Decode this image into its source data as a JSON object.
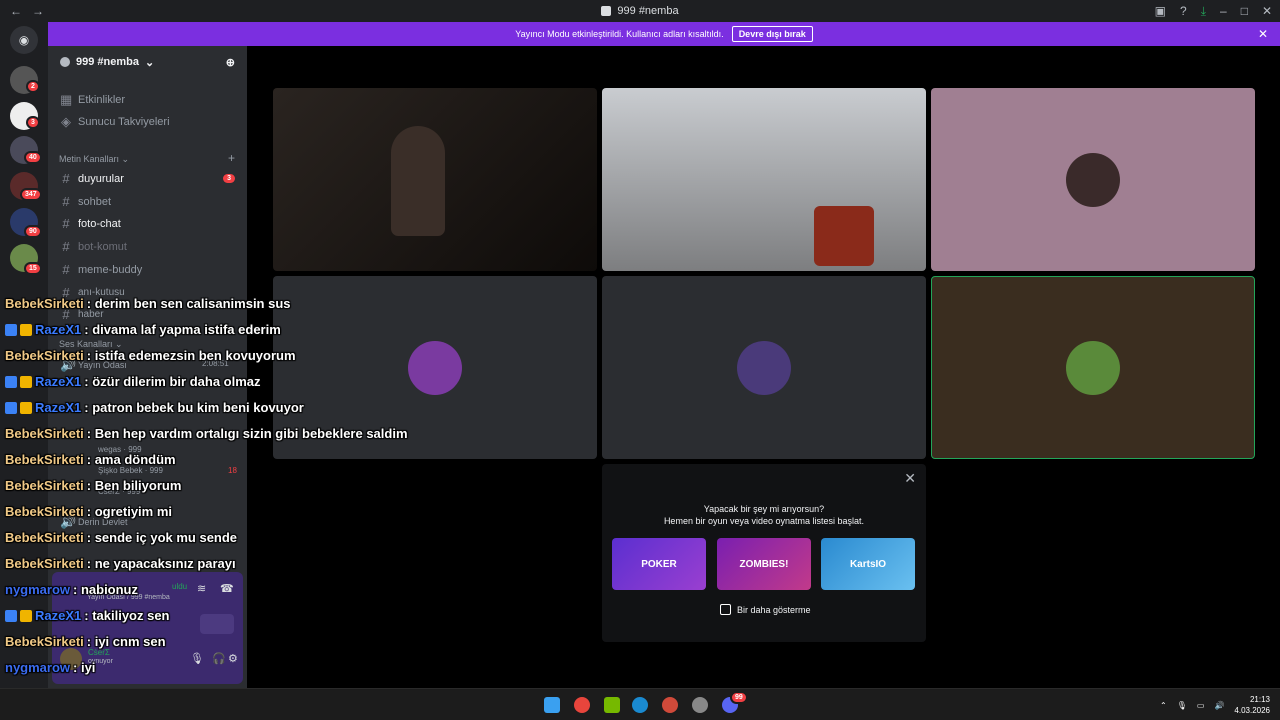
{
  "window": {
    "title": "999 #nemba",
    "back": "←",
    "forward": "→"
  },
  "banner": {
    "text": "Yayıncı Modu etkinleştirildi. Kullanıcı adları kısaltıldı.",
    "button": "Devre dışı bırak"
  },
  "server_badges": [
    "2",
    "3",
    "40",
    "347",
    "90",
    "15"
  ],
  "guild": {
    "name": "999 #nemba",
    "events": "Etkinlikler",
    "boosts": "Sunucu Takviyeleri",
    "text_category": "Metin Kanalları",
    "voice_category": "Ses Kanalları",
    "channels": [
      {
        "name": "duyurular",
        "badge": "3"
      },
      {
        "name": "sohbet"
      },
      {
        "name": "foto-chat"
      },
      {
        "name": "bot-komut"
      },
      {
        "name": "meme-buddy"
      },
      {
        "name": "anı-kutusu"
      },
      {
        "name": "haber"
      }
    ],
    "voice": {
      "room": "Yayın Odası",
      "timer": "2:08:51",
      "users": [
        {
          "name": "wegas",
          "tag": "999"
        },
        {
          "name": "Şişko Bebek",
          "tag": "999",
          "extra": "18"
        },
        {
          "name": "ĊṡëṙΣ",
          "tag": "999"
        }
      ],
      "other_room": "Derin Devlet"
    }
  },
  "user_panel": {
    "connected": "Yayın Odası / 999 #nemba",
    "status_suffix": "uldu",
    "status": "oynuyor",
    "username": "ĊṡëṙΣ"
  },
  "chat": [
    {
      "name": "BebekSirketi",
      "text": ": derim ben sen calisanimsin sus",
      "style": "bebek"
    },
    {
      "name": "RazeX1",
      "text": ": divama laf yapma istifa ederim",
      "style": "raze"
    },
    {
      "name": "BebekSirketi",
      "text": ": istifa edemezsin ben kovuyorum",
      "style": "bebek"
    },
    {
      "name": "RazeX1",
      "text": ": özür dilerim bir daha olmaz",
      "style": "raze"
    },
    {
      "name": "RazeX1",
      "text": ": patron bebek bu kim beni kovuyor",
      "style": "raze"
    },
    {
      "name": "BebekSirketi",
      "text": ": Ben hep vardım ortalıgı sizin gibi bebeklere saldim",
      "style": "bebek"
    },
    {
      "name": "BebekSirketi",
      "text": ": ama döndüm",
      "style": "bebek"
    },
    {
      "name": "BebekSirketi",
      "text": ": Ben biliyorum",
      "style": "bebek"
    },
    {
      "name": "BebekSirketi",
      "text": ": ogretiyim mi",
      "style": "bebek"
    },
    {
      "name": "BebekSirketi",
      "text": ": sende iç yok mu sende",
      "style": "bebek"
    },
    {
      "name": "BebekSirketi",
      "text": ": ne yapacaksınız parayı",
      "style": "bebek"
    },
    {
      "name": "nygmarow",
      "text": ": nabionuz",
      "style": "nyg"
    },
    {
      "name": "RazeX1",
      "text": ": takiliyoz sen",
      "style": "raze"
    },
    {
      "name": "BebekSirketi",
      "text": ": iyi cnm sen",
      "style": "bebek"
    },
    {
      "name": "nygmarow",
      "text": ": iyi",
      "style": "nyg"
    }
  ],
  "activity": {
    "line1": "Yapacak bir şey mi arıyorsun?",
    "line2": "Hemen bir oyun veya video oynatma listesi başlat.",
    "cards": [
      "POKER",
      "ZOMBIES!",
      "KartsIO"
    ],
    "checkbox": "Bir daha gösterme"
  },
  "taskbar": {
    "time": "21:13",
    "date": "4.03.2026",
    "discord_badge": "99"
  },
  "colors": {
    "banner": "#7b2fe0",
    "bebek": "#f0c987",
    "raze": "#3b7bff",
    "nyg": "#3b6cf0"
  }
}
